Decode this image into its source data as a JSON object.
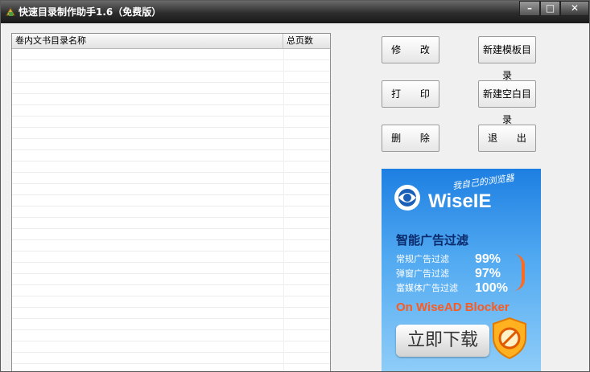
{
  "window": {
    "title": "快速目录制作助手1.6（免费版）",
    "controls": {
      "minimize": "–",
      "maximize": "□",
      "close": "✕"
    }
  },
  "list": {
    "columns": {
      "name": "卷内文书目录名称",
      "pages": "总页数"
    },
    "rows": []
  },
  "buttons": {
    "modify": "修 改",
    "new_template": "新建模板目录",
    "print": "打 印",
    "new_blank": "新建空白目录",
    "delete": "删 除",
    "exit": "退 出"
  },
  "ad": {
    "brand": "WiseIE",
    "slogan": "我自己的浏览器",
    "headline": "智能广告过滤",
    "stats": [
      {
        "label": "常规广告过滤",
        "value": "99%"
      },
      {
        "label": "弹窗广告过滤",
        "value": "97%"
      },
      {
        "label": "富媒体广告过滤",
        "value": "100%"
      }
    ],
    "cta": "On WiseAD Blocker",
    "download": "立即下载"
  },
  "colors": {
    "ad_bg": "#1d7fe2",
    "ad_accent": "#ff5a1e",
    "headline": "#0b2a6b"
  }
}
